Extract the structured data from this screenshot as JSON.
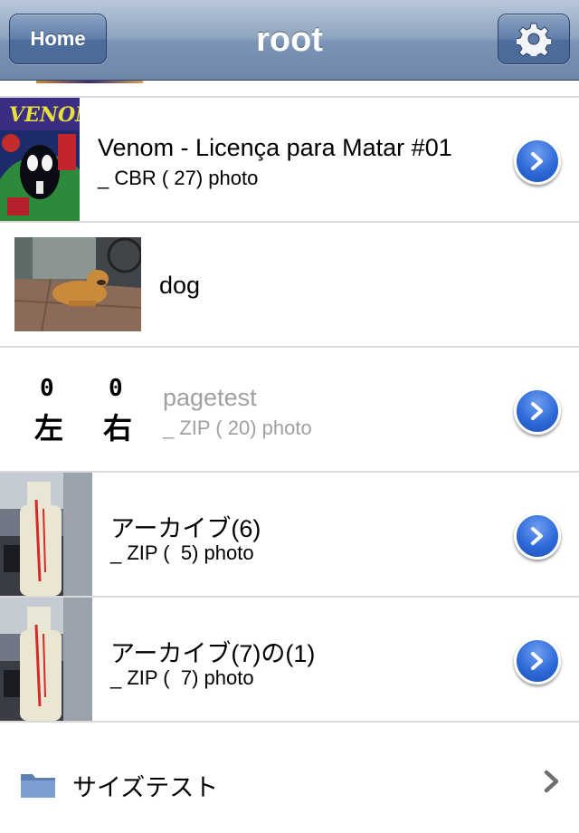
{
  "navbar": {
    "back_label": "Home",
    "title": "root",
    "settings_icon": "gear-icon"
  },
  "rows": [
    {
      "title": "Venom - Licença para Matar #01",
      "subtitle": "_ CBR ( 27) photo",
      "thumb": "comic-cover",
      "accessory": "detail-disclosure-icon"
    },
    {
      "title": "dog",
      "subtitle": "",
      "thumb": "dog-photo",
      "accessory": ""
    },
    {
      "title": "pagetest",
      "subtitle": "_ ZIP ( 20) photo",
      "thumb_text": [
        "0",
        "左",
        "0",
        "右"
      ],
      "accessory": "detail-disclosure-icon"
    },
    {
      "title": "アーカイブ(6)",
      "subtitle": "_ ZIP (  5) photo",
      "thumb": "bottle-photo",
      "accessory": "detail-disclosure-icon"
    },
    {
      "title": "アーカイブ(7)の(1)",
      "subtitle": "_ ZIP (  7) photo",
      "thumb": "bottle-photo",
      "accessory": "detail-disclosure-icon"
    },
    {
      "title": "サイズテスト",
      "icon": "folder-icon",
      "accessory": "chevron-right-icon"
    }
  ],
  "colors": {
    "navbar": "#7c94b5",
    "disclosure_blue": "#2e6ad8",
    "separator": "#d9d9d9",
    "dim_text": "#a0a0a0"
  }
}
